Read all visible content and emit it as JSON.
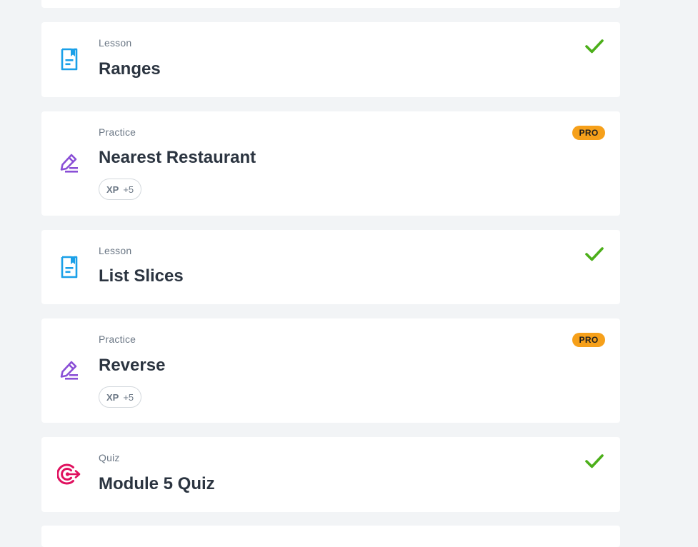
{
  "items": [
    {
      "type": "Lesson",
      "title": "Ranges",
      "status": "completed"
    },
    {
      "type": "Practice",
      "title": "Nearest Restaurant",
      "badge": "PRO",
      "xp_label": "XP",
      "xp_value": "+5"
    },
    {
      "type": "Lesson",
      "title": "List Slices",
      "status": "completed"
    },
    {
      "type": "Practice",
      "title": "Reverse",
      "badge": "PRO",
      "xp_label": "XP",
      "xp_value": "+5"
    },
    {
      "type": "Quiz",
      "title": "Module 5 Quiz",
      "status": "completed"
    }
  ],
  "icons": {
    "lesson": "lesson-document-icon",
    "practice": "practice-pencil-icon",
    "quiz": "quiz-target-icon",
    "completed": "checkmark-icon"
  },
  "colors": {
    "lesson_icon": "#1aa0e8",
    "practice_icon": "#8a4fd6",
    "quiz_icon": "#e0115f",
    "check": "#4caf1a",
    "pro_badge": "#f6a01a"
  }
}
